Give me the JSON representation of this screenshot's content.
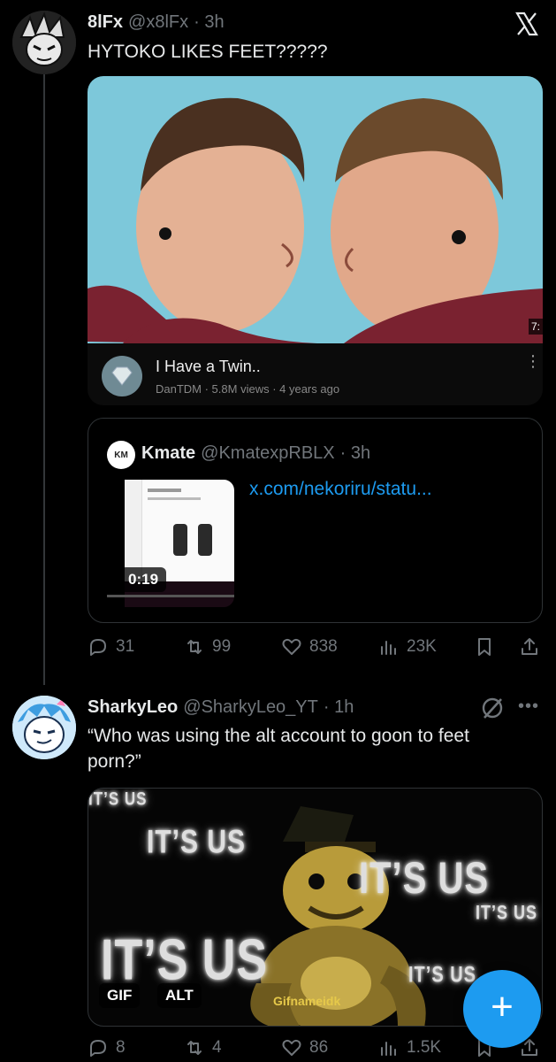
{
  "tweet1": {
    "name": "8lFx",
    "handle": "@x8lFx",
    "time": "· 3h",
    "text": "HYTOKO LIKES FEET?????",
    "video": {
      "title": "I Have a Twin..",
      "meta": "DanTDM · 5.8M views · 4 years ago",
      "duration_partial": "7:"
    },
    "quote": {
      "name": "Kmate",
      "handle": "@KmatexpRBLX",
      "time": "· 3h",
      "link": "x.com/nekoriru/statu...",
      "duration": "0:19"
    },
    "actions": {
      "replies": "31",
      "reposts": "99",
      "likes": "838",
      "views": "23K"
    }
  },
  "tweet2": {
    "name": "SharkyLeo",
    "handle": "@SharkyLeo_YT",
    "time": "· 1h",
    "text": "“Who was using the alt account to goon to feet porn?”",
    "gif": {
      "badge_gif": "GIF",
      "badge_alt": "ALT",
      "watermark": "Gifnameidk",
      "its_us": [
        "IT’S US",
        "IT’S US",
        "IT’S US",
        "IT’S US",
        "IT’S US",
        "IT’S US"
      ]
    },
    "actions": {
      "replies": "8",
      "reposts": "4",
      "likes": "86",
      "views": "1.5K"
    }
  },
  "fab": {
    "label": "+"
  },
  "colors": {
    "background": "#000000",
    "text": "#e7e9ea",
    "muted": "#71767b",
    "accent": "#1d9bf0",
    "border": "#2f3336"
  },
  "icons": [
    "x-logo-icon",
    "reply-icon",
    "repost-icon",
    "like-icon",
    "views-icon",
    "bookmark-icon",
    "share-icon",
    "grok-icon",
    "more-icon",
    "compose-icon"
  ]
}
